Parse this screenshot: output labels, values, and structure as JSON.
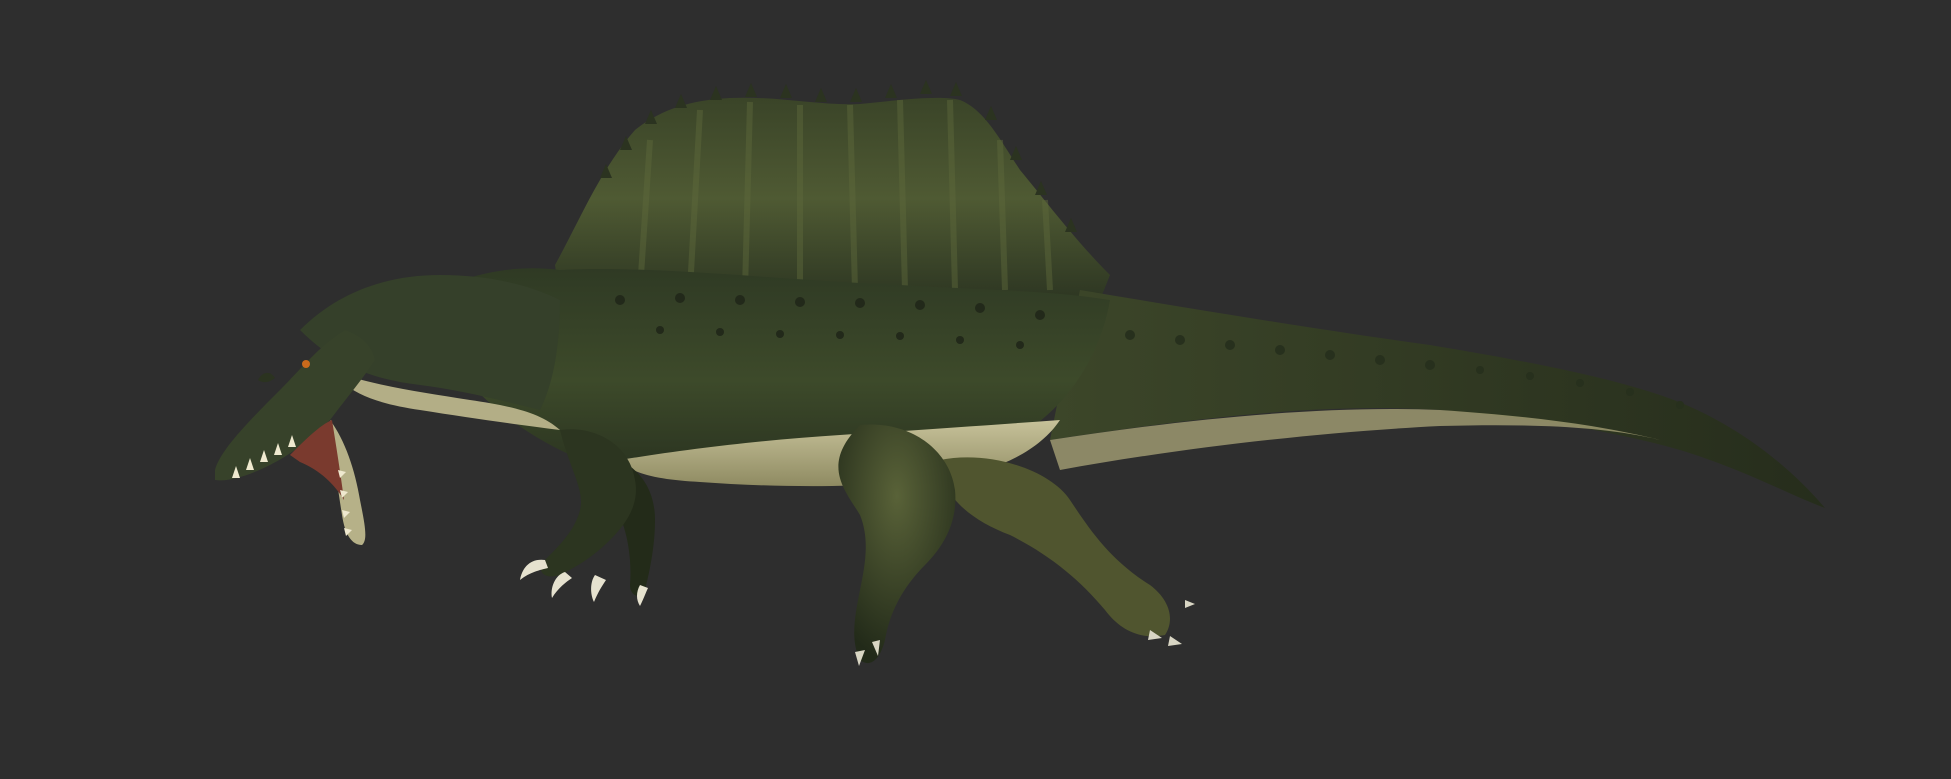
{
  "scene": {
    "subject": "spinosaurus-model",
    "background_color": "#2e2e2e",
    "colors": {
      "skin_dark": "#2a3320",
      "skin_mid": "#4a5532",
      "skin_highlight": "#7d7f4a",
      "belly": "#b9b48a",
      "belly_shadow": "#6b6a46",
      "mouth": "#7a3a2e",
      "teeth": "#efe9cf",
      "claws": "#d9d6c4",
      "eye": "#c96a1c"
    }
  }
}
